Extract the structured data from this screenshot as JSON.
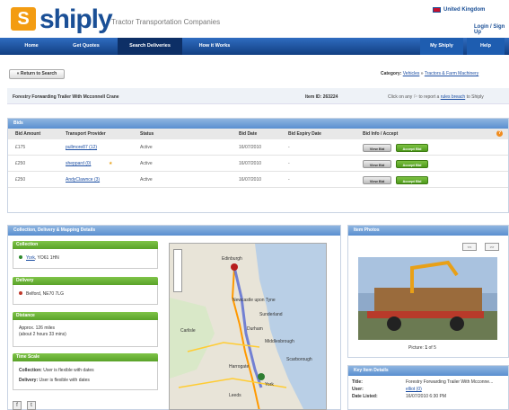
{
  "header": {
    "logo_mark": "S",
    "logo_text": "shiply",
    "tagline": "Tractor Transportation Companies",
    "region": "United Kingdom",
    "login": "Login",
    "signup": "Sign Up"
  },
  "nav": {
    "home": "Home",
    "quotes": "Get Quotes",
    "search": "Search Deliveries",
    "how": "How it Works",
    "myshiply": "My Shiply",
    "help": "Help"
  },
  "toolbar": {
    "return": "« Return to Search",
    "category_label": "Category:",
    "cat1": "Vehicles",
    "cat_sep": "»",
    "cat2": "Tractors & Farm Machinery"
  },
  "listing": {
    "title": "Forestry Forwarding Trailer With Mcconnell Crane",
    "item_id_label": "Item ID:",
    "item_id": "263224",
    "report_pre": "Click on any",
    "report_mid": "to report a",
    "report_link": "rules breach",
    "report_post": "to Shiply"
  },
  "bids": {
    "header": "Bids",
    "cols": [
      "Bid Amount",
      "Transport Provider",
      "Status",
      "Bid Date",
      "Bid Expiry Date",
      "Bid Info / Accept"
    ],
    "rows": [
      {
        "amount": "£175",
        "provider": "pullmore87 (12)",
        "status": "Active",
        "date": "16/07/2010",
        "expiry": "-",
        "view": "View Bid",
        "accept": "Accept Bid"
      },
      {
        "amount": "£250",
        "provider": "sheppard (0)",
        "status": "Active",
        "date": "16/07/2010",
        "expiry": "-",
        "view": "View Bid",
        "accept": "Accept Bid"
      },
      {
        "amount": "£250",
        "provider": "AndyClawnce (3)",
        "status": "Active",
        "date": "16/07/2010",
        "expiry": "-",
        "view": "View Bid",
        "accept": "Accept Bid"
      }
    ]
  },
  "details": {
    "header": "Collection, Delivery & Mapping Details",
    "collection_h": "Collection",
    "collection_link": "York",
    "collection_rest": ", YO61 1HN",
    "delivery_h": "Delivery",
    "delivery_v": "Belford, NE70 7LG",
    "distance_h": "Distance",
    "distance_v1": "Approx. 126 miles",
    "distance_v2": "(about 2 hours 33 mins)",
    "time_h": "Time Scale",
    "time_c_label": "Collection:",
    "time_c": "User is flexible with dates",
    "time_d_label": "Delivery:",
    "time_d": "User is flexible with dates"
  },
  "map": {
    "labels": [
      "Edinburgh",
      "Newcastle upon Tyne",
      "Sunderland",
      "Durham",
      "Carlisle",
      "Middlesbrough",
      "Harrogate",
      "York",
      "Leeds",
      "Scarborough"
    ]
  },
  "photos": {
    "header": "Item Photos",
    "prev": "<<",
    "next": ">>",
    "caption_pre": "Picture:",
    "current": "1",
    "of": "of",
    "total": "5"
  },
  "keydetails": {
    "header": "Key Item Details",
    "title_label": "Title:",
    "title_val": "Forestry Forwarding Trailer With Mcconne...",
    "user_label": "User:",
    "user_val": "elliot (0)",
    "date_label": "Date Listed:",
    "date_val": "16/07/2010 6:30 PM"
  }
}
